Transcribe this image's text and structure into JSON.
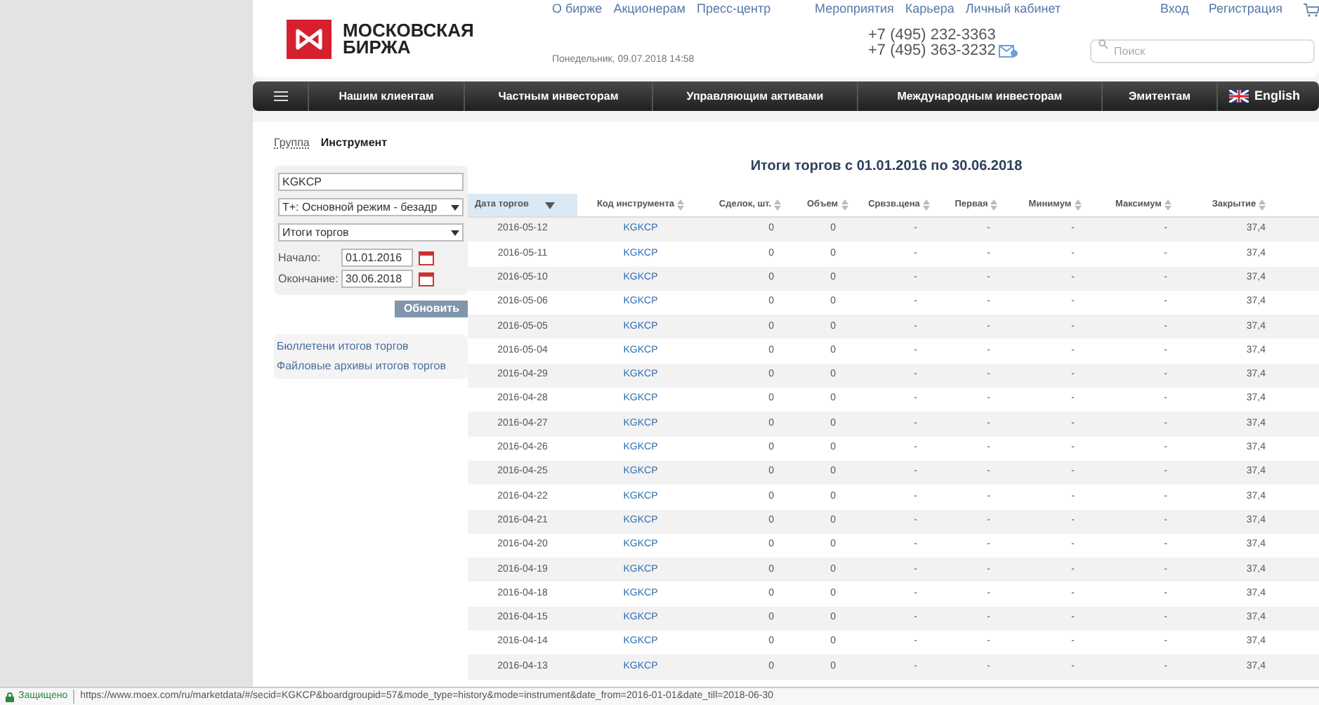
{
  "header": {
    "logo_text": [
      "МОСКОВСКАЯ",
      "БИРЖА"
    ],
    "top_links": [
      "О бирже",
      "Акционерам",
      "Пресс-центр",
      "Мероприятия",
      "Карьера",
      "Личный кабинет"
    ],
    "auth_links": [
      "Вход",
      "Регистрация"
    ],
    "date": "Понедельник, 09.07.2018 14:58",
    "phones": [
      "+7 (495) 232-3363",
      "+7 (495) 363-3232"
    ],
    "search": {
      "placeholder": "Поиск"
    }
  },
  "nav": {
    "items": [
      "Нашим клиентам",
      "Частным инвесторам",
      "Управляющим активами",
      "Международным инвесторам",
      "Эмитентам"
    ],
    "language": "English"
  },
  "mode_tabs": [
    {
      "label": "Группа",
      "selected": false
    },
    {
      "label": "Инструмент",
      "selected": true
    }
  ],
  "filters": {
    "instrument": "KGKCP",
    "board": "Т+: Основной режим - безадр",
    "report": "Итоги торгов",
    "start_label": "Начало:",
    "start": "01.01.2016",
    "end_label": "Окончание:",
    "end": "30.06.2018",
    "refresh": "Обновить"
  },
  "links": [
    "Бюллетени итогов торгов",
    "Файловые архивы итогов торгов"
  ],
  "table": {
    "title": "Итоги торгов с 01.01.2016 по 30.06.2018",
    "columns": [
      {
        "label": "Дата торгов",
        "sorted": true
      },
      {
        "label": "Код инструмента",
        "sorted": false
      },
      {
        "label": "Сделок, шт.",
        "sorted": false
      },
      {
        "label": "Объем",
        "sorted": false
      },
      {
        "label": "Срвзв.цена",
        "sorted": false
      },
      {
        "label": "Первая",
        "sorted": false
      },
      {
        "label": "Минимум",
        "sorted": false
      },
      {
        "label": "Максимум",
        "sorted": false
      },
      {
        "label": "Закрытие",
        "sorted": false
      }
    ],
    "rows": [
      [
        "2016-05-12",
        "KGKCP",
        "0",
        "0",
        "-",
        "-",
        "-",
        "-",
        "37,4"
      ],
      [
        "2016-05-11",
        "KGKCP",
        "0",
        "0",
        "-",
        "-",
        "-",
        "-",
        "37,4"
      ],
      [
        "2016-05-10",
        "KGKCP",
        "0",
        "0",
        "-",
        "-",
        "-",
        "-",
        "37,4"
      ],
      [
        "2016-05-06",
        "KGKCP",
        "0",
        "0",
        "-",
        "-",
        "-",
        "-",
        "37,4"
      ],
      [
        "2016-05-05",
        "KGKCP",
        "0",
        "0",
        "-",
        "-",
        "-",
        "-",
        "37,4"
      ],
      [
        "2016-05-04",
        "KGKCP",
        "0",
        "0",
        "-",
        "-",
        "-",
        "-",
        "37,4"
      ],
      [
        "2016-04-29",
        "KGKCP",
        "0",
        "0",
        "-",
        "-",
        "-",
        "-",
        "37,4"
      ],
      [
        "2016-04-28",
        "KGKCP",
        "0",
        "0",
        "-",
        "-",
        "-",
        "-",
        "37,4"
      ],
      [
        "2016-04-27",
        "KGKCP",
        "0",
        "0",
        "-",
        "-",
        "-",
        "-",
        "37,4"
      ],
      [
        "2016-04-26",
        "KGKCP",
        "0",
        "0",
        "-",
        "-",
        "-",
        "-",
        "37,4"
      ],
      [
        "2016-04-25",
        "KGKCP",
        "0",
        "0",
        "-",
        "-",
        "-",
        "-",
        "37,4"
      ],
      [
        "2016-04-22",
        "KGKCP",
        "0",
        "0",
        "-",
        "-",
        "-",
        "-",
        "37,4"
      ],
      [
        "2016-04-21",
        "KGKCP",
        "0",
        "0",
        "-",
        "-",
        "-",
        "-",
        "37,4"
      ],
      [
        "2016-04-20",
        "KGKCP",
        "0",
        "0",
        "-",
        "-",
        "-",
        "-",
        "37,4"
      ],
      [
        "2016-04-19",
        "KGKCP",
        "0",
        "0",
        "-",
        "-",
        "-",
        "-",
        "37,4"
      ],
      [
        "2016-04-18",
        "KGKCP",
        "0",
        "0",
        "-",
        "-",
        "-",
        "-",
        "37,4"
      ],
      [
        "2016-04-15",
        "KGKCP",
        "0",
        "0",
        "-",
        "-",
        "-",
        "-",
        "37,4"
      ],
      [
        "2016-04-14",
        "KGKCP",
        "0",
        "0",
        "-",
        "-",
        "-",
        "-",
        "37,4"
      ],
      [
        "2016-04-13",
        "KGKCP",
        "0",
        "0",
        "-",
        "-",
        "-",
        "-",
        "37,4"
      ]
    ]
  },
  "status_bar": {
    "secure": "Защищено",
    "url": "https://www.moex.com/ru/marketdata/#/secid=KGKCP&boardgroupid=57&mode_type=history&mode=instrument&date_from=2016-01-01&date_till=2018-06-30"
  }
}
